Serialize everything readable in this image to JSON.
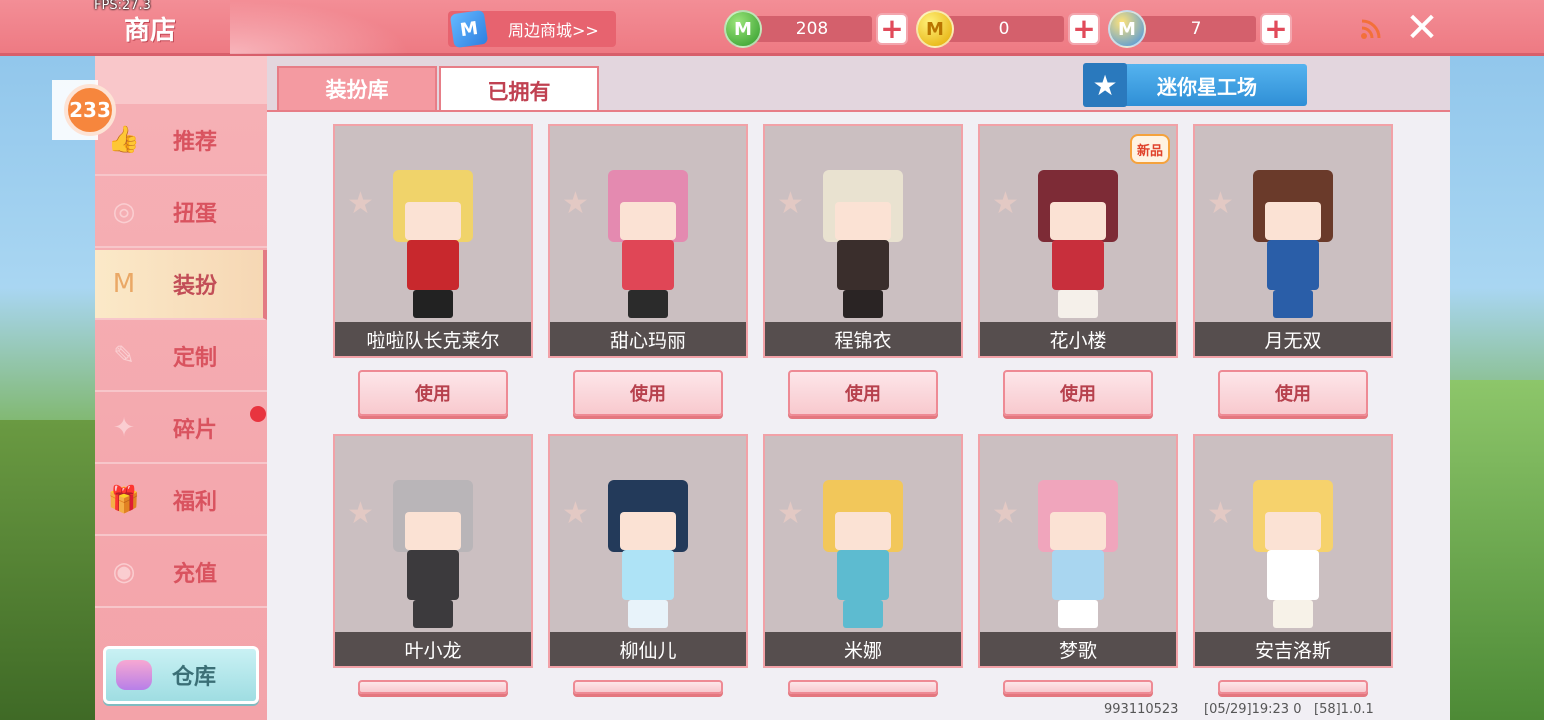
{
  "fps": "FPS:27.3",
  "header": {
    "title": "商店",
    "mall_link": "周边商城>>",
    "mall_icon": "M",
    "currencies": [
      {
        "name": "mini-bean",
        "icon": "M",
        "color": "#2f9a2a",
        "value": "208"
      },
      {
        "name": "mini-coin",
        "icon": "M",
        "color": "#e3a900",
        "value": "0"
      },
      {
        "name": "mini-point",
        "icon": "M",
        "color": "#3e8fe6",
        "value": "7"
      }
    ],
    "close_icon": "✕"
  },
  "sidebar": {
    "badge": "233",
    "items": [
      {
        "label": "推荐",
        "icon": "thumbs-up-icon",
        "glyph": "👍"
      },
      {
        "label": "扭蛋",
        "icon": "gacha-icon",
        "glyph": "◎"
      },
      {
        "label": "装扮",
        "icon": "outfit-icon",
        "glyph": "M"
      },
      {
        "label": "定制",
        "icon": "pencil-icon",
        "glyph": "✎"
      },
      {
        "label": "碎片",
        "icon": "fragment-icon",
        "glyph": "✦"
      },
      {
        "label": "福利",
        "icon": "gift-icon",
        "glyph": "🎁"
      },
      {
        "label": "充值",
        "icon": "coins-icon",
        "glyph": "◉"
      }
    ],
    "active_index": 2,
    "warehouse": "仓库"
  },
  "tabs": [
    {
      "label": "装扮库",
      "active": false
    },
    {
      "label": "已拥有",
      "active": true
    }
  ],
  "factory_button": "迷你星工场",
  "cards": [
    {
      "name": "啦啦队长克莱尔",
      "use": "使用",
      "hair": "#f0d36a",
      "body": "#c8282d",
      "legs": "#222"
    },
    {
      "name": "甜心玛丽",
      "use": "使用",
      "hair": "#e48ab0",
      "body": "#e04656",
      "legs": "#2b2b2b"
    },
    {
      "name": "程锦衣",
      "use": "使用",
      "hair": "#e9e2d0",
      "body": "#3a2e2c",
      "legs": "#2a2424"
    },
    {
      "name": "花小楼",
      "use": "使用",
      "hair": "#7d2b36",
      "body": "#c82f3c",
      "legs": "#f5f0ea",
      "tag": "新品"
    },
    {
      "name": "月无双",
      "use": "使用",
      "hair": "#6a3a2a",
      "body": "#2a5ea8",
      "legs": "#2a5ea8"
    },
    {
      "name": "叶小龙",
      "use": "",
      "hair": "#b9b5b8",
      "body": "#3c3a3d",
      "legs": "#3c3a3d"
    },
    {
      "name": "柳仙儿",
      "use": "",
      "hair": "#233a5a",
      "body": "#aee3f6",
      "legs": "#e8f3fa"
    },
    {
      "name": "米娜",
      "use": "",
      "hair": "#f2c75a",
      "body": "#5dbbd0",
      "legs": "#5dbbd0"
    },
    {
      "name": "梦歌",
      "use": "",
      "hair": "#f0a5bc",
      "body": "#a9d6f0",
      "legs": "#ffffff"
    },
    {
      "name": "安吉洛斯",
      "use": "",
      "hair": "#f6d26c",
      "body": "#ffffff",
      "legs": "#f7f2e8"
    }
  ],
  "status_bar": {
    "uid": "993110523",
    "datetime": "[05/29]19:23 0",
    "version": "[58]1.0.1"
  }
}
